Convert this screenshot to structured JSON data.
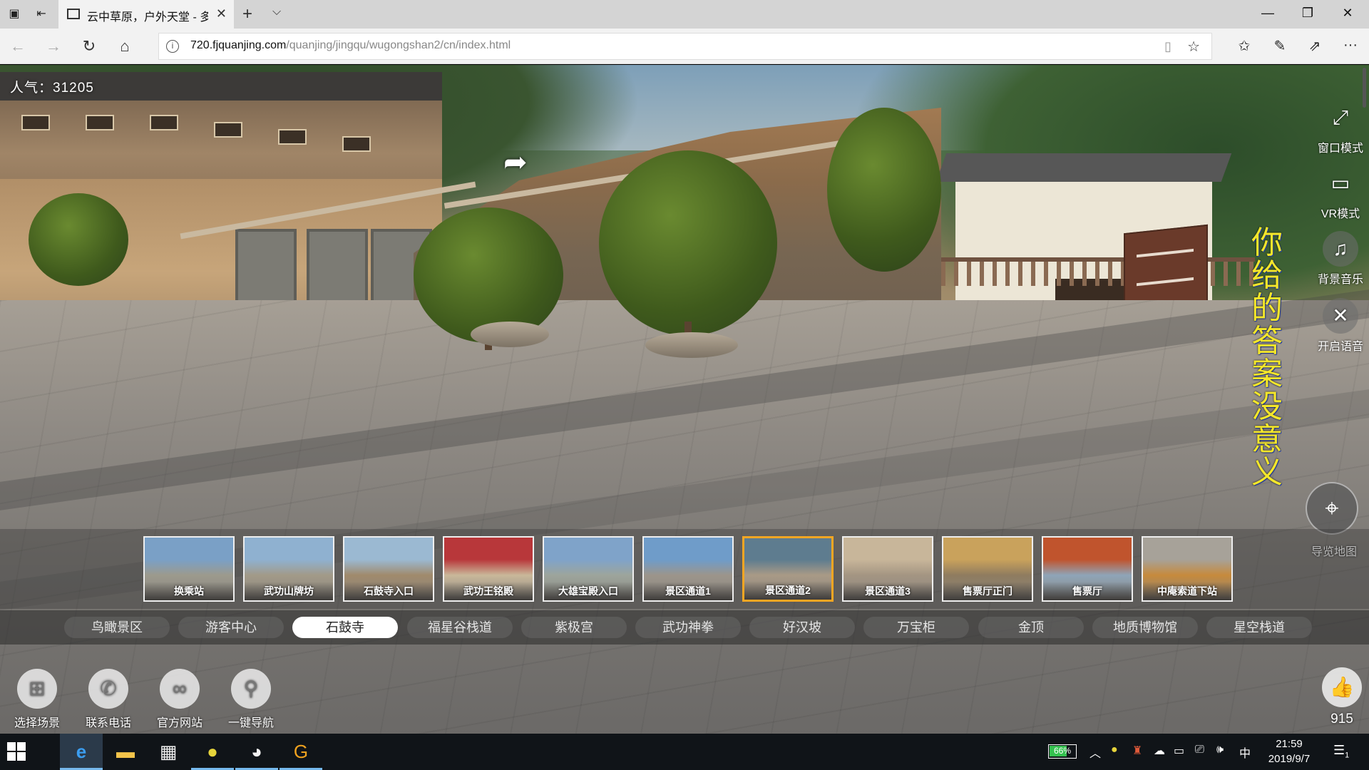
{
  "browser": {
    "tab_title": "云中草原，户外天堂 - 多",
    "url_host": "720.fjquanjing.com",
    "url_path": "/quanjing/jingqu/wugongshan2/cn/index.html"
  },
  "pano": {
    "popularity": "人气：31205",
    "lyric": "你给的答案没意义",
    "right_tools": [
      {
        "label": "窗口模式",
        "icon": "fullscreen-icon"
      },
      {
        "label": "VR模式",
        "icon": "vr-headset-icon"
      },
      {
        "label": "背景音乐",
        "icon": "music-off-icon"
      },
      {
        "label": "开启语音",
        "icon": "voice-off-icon"
      }
    ],
    "map_label": "导览地图",
    "thumbnails": [
      {
        "label": "换乘站",
        "color1": "#7aa0c6",
        "color2": "#9c9a8d"
      },
      {
        "label": "武功山牌坊",
        "color1": "#8fb1d0",
        "color2": "#a29a88"
      },
      {
        "label": "石鼓寺入口",
        "color1": "#9bb9d2",
        "color2": "#a08a6c"
      },
      {
        "label": "武功王铭殿",
        "color1": "#b8373a",
        "color2": "#c9b89a"
      },
      {
        "label": "大雄宝殿入口",
        "color1": "#7fa3c9",
        "color2": "#9da59c"
      },
      {
        "label": "景区通道1",
        "color1": "#6f9cc9",
        "color2": "#9c958b"
      },
      {
        "label": "景区通道2",
        "color1": "#5e7c8f",
        "color2": "#a99a86"
      },
      {
        "label": "景区通道3",
        "color1": "#c8b69a",
        "color2": "#a49582"
      },
      {
        "label": "售票厅正门",
        "color1": "#c9a25c",
        "color2": "#8f7c5f"
      },
      {
        "label": "售票厅",
        "color1": "#c0542d",
        "color2": "#8fa5b8"
      },
      {
        "label": "中庵索道下站",
        "color1": "#a7a299",
        "color2": "#c68a3c"
      }
    ],
    "active_thumbnail": "景区通道2",
    "categories": [
      "鸟瞰景区",
      "游客中心",
      "石鼓寺",
      "福星谷栈道",
      "紫极宫",
      "武功神拳",
      "好汉坡",
      "万宝柜",
      "金顶",
      "地质博物馆",
      "星空栈道"
    ],
    "active_category": "石鼓寺",
    "bottom_tools": [
      {
        "label": "选择场景",
        "icon": "grid-icon"
      },
      {
        "label": "联系电话",
        "icon": "phone-icon"
      },
      {
        "label": "官方网站",
        "icon": "link-icon"
      },
      {
        "label": "一键导航",
        "icon": "location-pin-icon"
      }
    ],
    "likes": "915"
  },
  "taskbar": {
    "battery": "66%",
    "battery_level": 0.66,
    "ime": "中",
    "time": "21:59",
    "date": "2019/9/7",
    "notifications": "1"
  }
}
